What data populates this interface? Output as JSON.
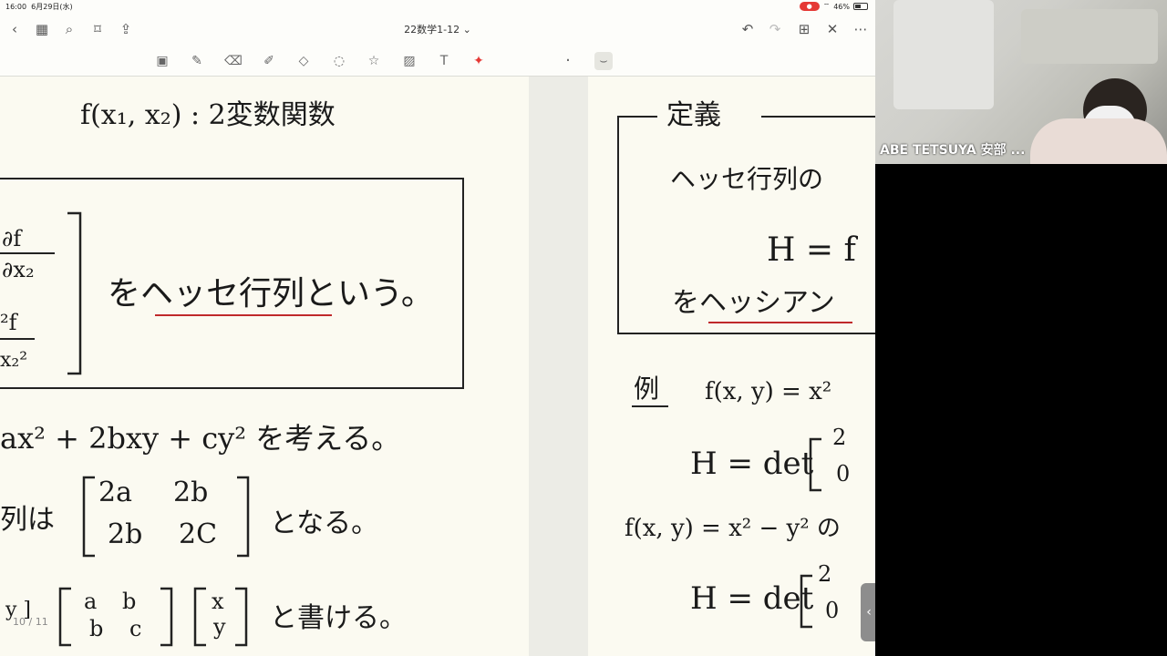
{
  "statusbar": {
    "time": "16:00",
    "date": "6月29日(水)",
    "battery": "46%"
  },
  "navbar": {
    "title": "22数学1-12 ⌄"
  },
  "icons": {
    "back": "chevron-left-icon",
    "grid": "grid-icon",
    "search": "search-icon",
    "bookmark": "bookmark-icon",
    "share": "share-icon",
    "undo": "undo-icon",
    "redo": "redo-icon",
    "add-page": "add-page-icon",
    "close": "close-icon",
    "more": "more-icon"
  },
  "left_page": {
    "line1": "f(x₁, x₂) :  2変数関数",
    "frag_a": "∂f",
    "frag_b": "∂x₂",
    "frag_c": "²f",
    "frag_d": "x₂²",
    "box_text": "をヘッセ行列という。",
    "line2": "ax² + 2bxy + cy²  を考える。",
    "line3_prefix": "列は",
    "matrix1": [
      "2a",
      "2b",
      "2b",
      "2C"
    ],
    "line3_suffix": "となる。",
    "line4_prefix": "y ]",
    "matrix2": [
      "a",
      "b",
      "b",
      "c"
    ],
    "matrix3": [
      "x",
      "y"
    ],
    "line4_suffix": "と書ける。"
  },
  "right_page": {
    "heading": "定義",
    "line1": "ヘッセ行列の",
    "line2": "H = f",
    "line3": "をヘッシアン",
    "example_label": "例",
    "example_fx": "f(x, y) = x²",
    "h1": "H = det",
    "h1_matrix": [
      "2",
      "0"
    ],
    "fx2": "f(x, y) = x² − y² の",
    "h2": "H = det",
    "h2_matrix": [
      "2",
      "0"
    ]
  },
  "page_indicator": "10 / 11",
  "video": {
    "name": "ABE TETSUYA 安部 ..."
  }
}
